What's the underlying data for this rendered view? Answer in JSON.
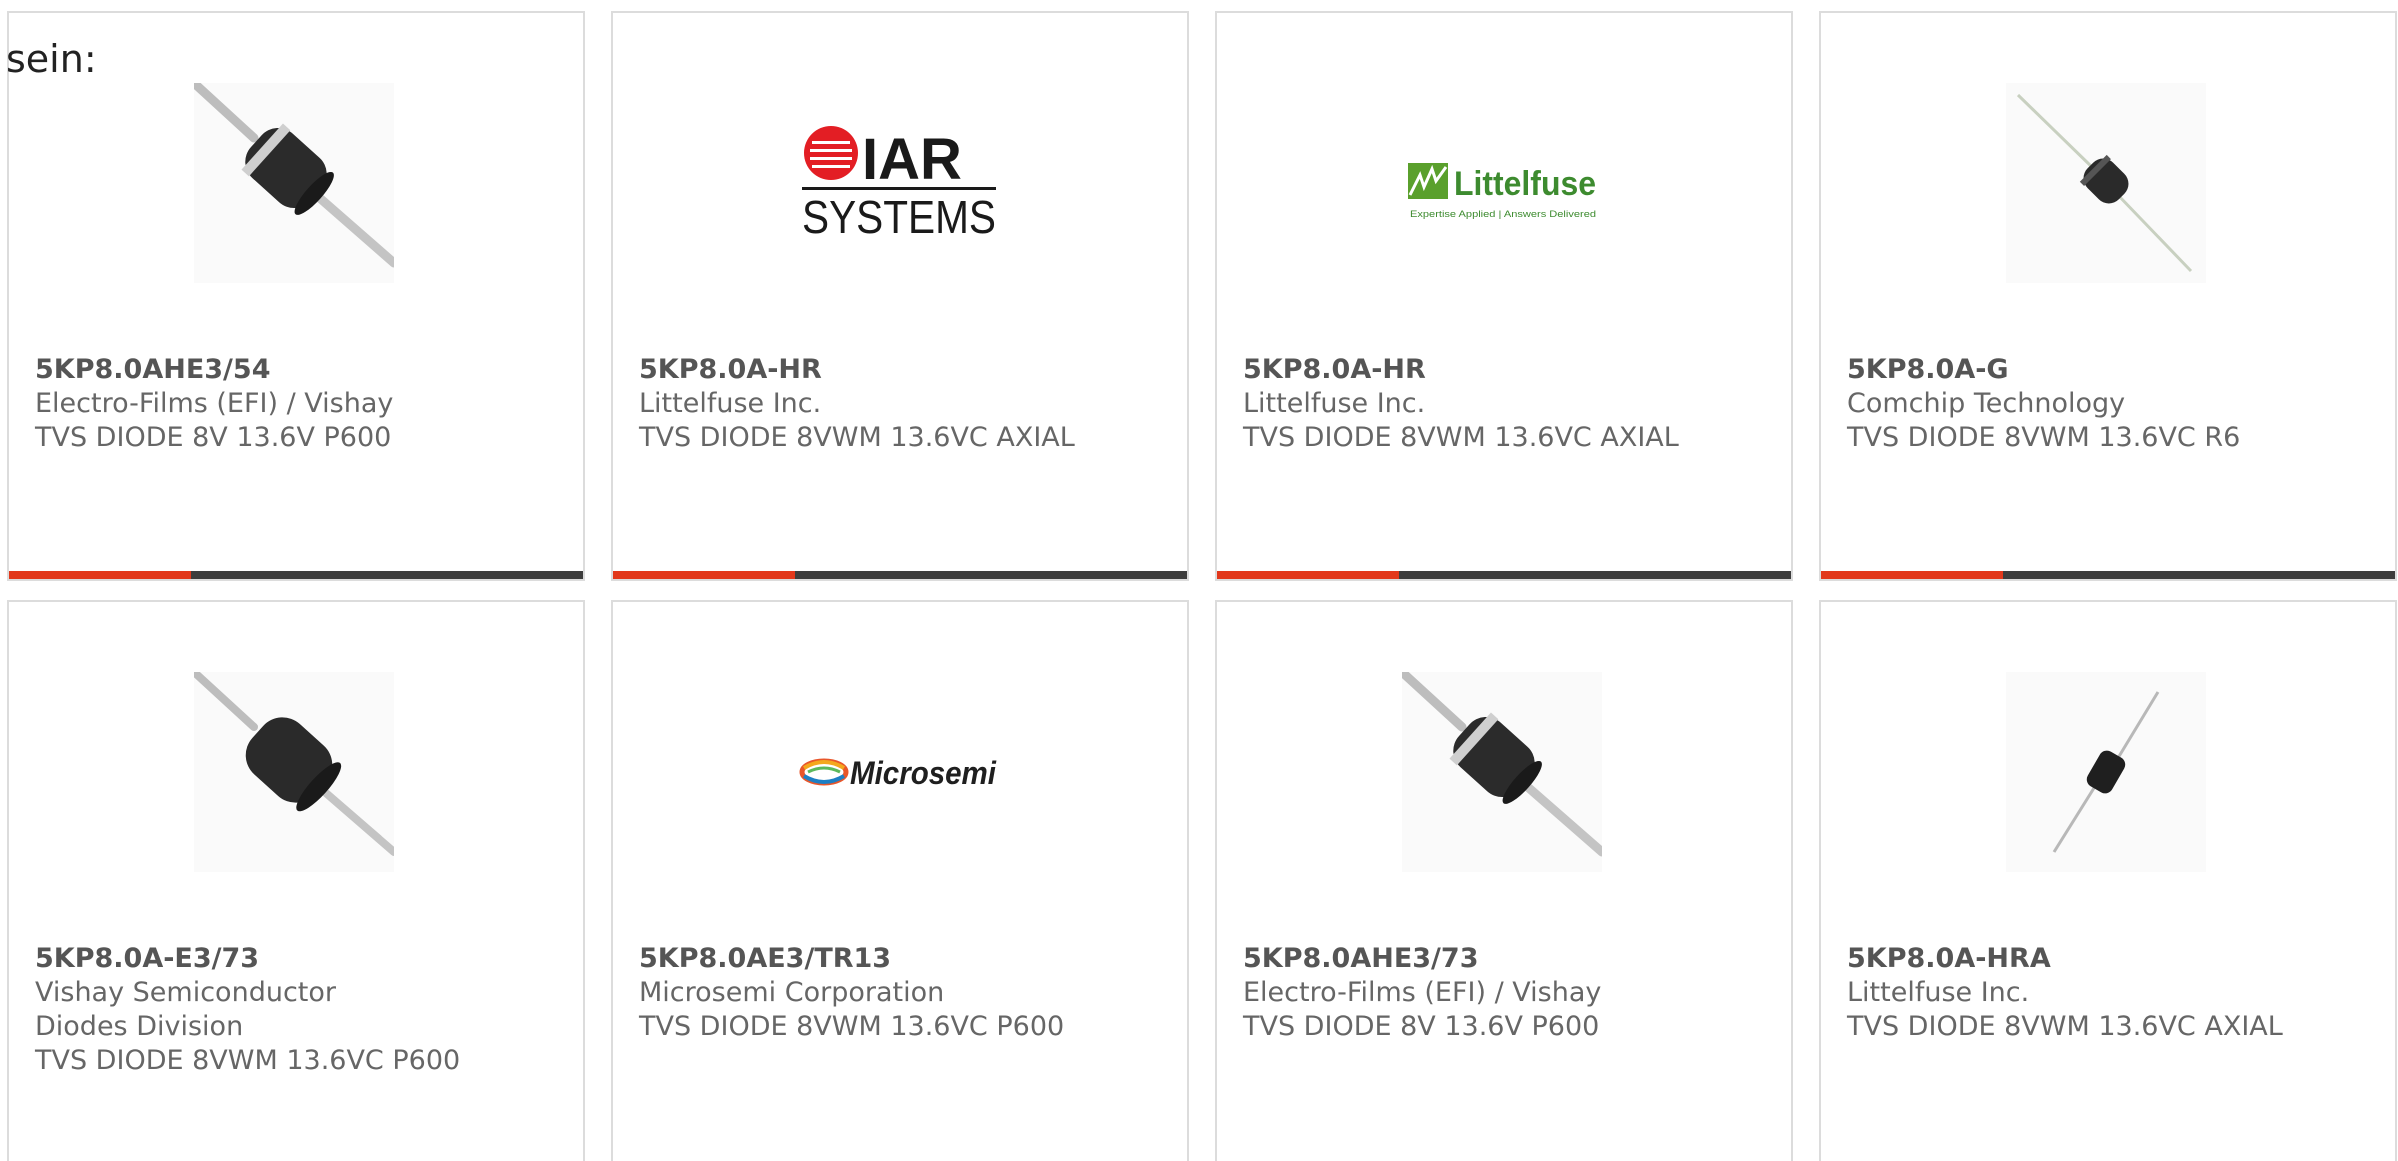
{
  "intro_text": "sein:",
  "colors": {
    "accent": "#e2381b",
    "bar_dark": "#3d3d3d",
    "border": "#dcdcdc",
    "text": "#666666"
  },
  "products": [
    {
      "part_number": "5KP8.0AHE3/54",
      "manufacturer": "Electro-Films (EFI) / Vishay",
      "description": "TVS DIODE 8V 13.6V P600",
      "image": "axial-diode-with-band"
    },
    {
      "part_number": "5KP8.0A-HR",
      "manufacturer": "Littelfuse Inc.",
      "description": "TVS DIODE 8VWM 13.6VC AXIAL",
      "image": "iar-systems-logo",
      "logo_text_top": "IAR",
      "logo_text_bottom": "SYSTEMS"
    },
    {
      "part_number": "5KP8.0A-HR",
      "manufacturer": "Littelfuse Inc.",
      "description": "TVS DIODE 8VWM 13.6VC AXIAL",
      "image": "littelfuse-logo",
      "logo_text": "Littelfuse",
      "logo_tagline": "Expertise Applied | Answers Delivered"
    },
    {
      "part_number": "5KP8.0A-G",
      "manufacturer": "Comchip Technology",
      "description": "TVS DIODE 8VWM 13.6VC R6",
      "image": "axial-diode-small"
    },
    {
      "part_number": "5KP8.0A-E3/73",
      "manufacturer": "Vishay Semiconductor Diodes Division",
      "description": "TVS DIODE 8VWM 13.6VC P600",
      "image": "axial-diode-large"
    },
    {
      "part_number": "5KP8.0AE3/TR13",
      "manufacturer": "Microsemi Corporation",
      "description": "TVS DIODE 8VWM 13.6VC P600",
      "image": "microsemi-logo",
      "logo_text": "Microsemi"
    },
    {
      "part_number": "5KP8.0AHE3/73",
      "manufacturer": "Electro-Films (EFI) / Vishay",
      "description": "TVS DIODE 8V 13.6V P600",
      "image": "axial-diode-with-band"
    },
    {
      "part_number": "5KP8.0A-HRA",
      "manufacturer": "Littelfuse Inc.",
      "description": "TVS DIODE 8VWM 13.6VC AXIAL",
      "image": "axial-diode-thin"
    }
  ]
}
